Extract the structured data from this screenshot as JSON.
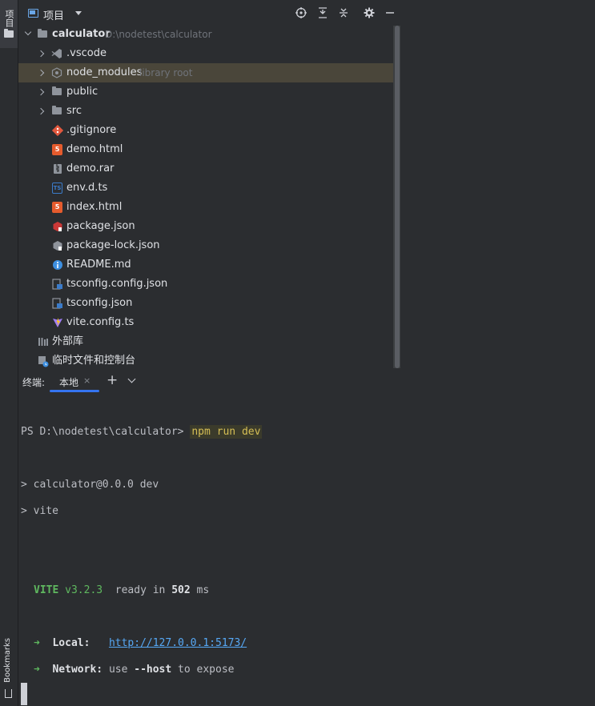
{
  "left_stripe": {
    "project_tool_label": "项目",
    "bookmarks_label": "Bookmarks"
  },
  "header": {
    "title": "项目"
  },
  "tree": {
    "root": {
      "name": "calculator",
      "path": "D:\\nodetest\\calculator"
    },
    "items": [
      {
        "name": ".vscode",
        "kind": "folder"
      },
      {
        "name": "node_modules",
        "kind": "folder",
        "hint": "library root"
      },
      {
        "name": "public",
        "kind": "folder"
      },
      {
        "name": "src",
        "kind": "folder"
      },
      {
        "name": ".gitignore",
        "kind": "file",
        "icon": "git-icon"
      },
      {
        "name": "demo.html",
        "kind": "file",
        "icon": "html-icon"
      },
      {
        "name": "demo.rar",
        "kind": "file",
        "icon": "archive-icon"
      },
      {
        "name": "env.d.ts",
        "kind": "file",
        "icon": "typescript-icon"
      },
      {
        "name": "index.html",
        "kind": "file",
        "icon": "html-icon"
      },
      {
        "name": "package.json",
        "kind": "file",
        "icon": "npm-icon"
      },
      {
        "name": "package-lock.json",
        "kind": "file",
        "icon": "npm-lock-icon"
      },
      {
        "name": "README.md",
        "kind": "file",
        "icon": "info-icon"
      },
      {
        "name": "tsconfig.config.json",
        "kind": "file",
        "icon": "tsconfig-icon"
      },
      {
        "name": "tsconfig.json",
        "kind": "file",
        "icon": "tsconfig-icon"
      },
      {
        "name": "vite.config.ts",
        "kind": "file",
        "icon": "vite-icon"
      }
    ],
    "external_libraries": "外部库",
    "scratches": "临时文件和控制台"
  },
  "terminal_tabs": {
    "label": "终端:",
    "tab": "本地",
    "close": "×",
    "add": "+"
  },
  "terminal": {
    "prompt": "PS D:\\nodetest\\calculator>",
    "command": "npm run dev",
    "line1": "> calculator@0.0.0 dev",
    "line2": "> vite",
    "vite_name": "VITE",
    "vite_version": "v3.2.3",
    "ready_text": "ready in",
    "ready_ms": "502",
    "ms_unit": "ms",
    "arrow": "➜",
    "local_label": "Local:",
    "local_url": "http://127.0.0.1:5173/",
    "network_label": "Network:",
    "network_use": "use",
    "network_flag": "--host",
    "network_rest": "to expose"
  },
  "colors": {
    "selection": "#4a463a",
    "accent": "#3574f0",
    "vite_green": "#5fb85f",
    "link": "#56a8f5"
  }
}
